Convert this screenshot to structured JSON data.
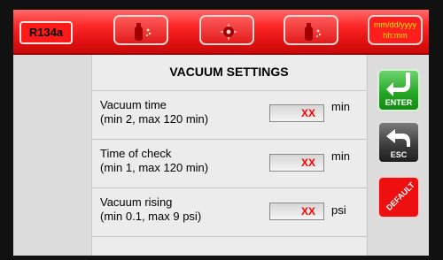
{
  "topbar": {
    "refrigerant": "R134a",
    "datetime_line1": "mm/dd/yyyy",
    "datetime_line2": "hh:mm",
    "icons": [
      "recovery-bottle-icon",
      "vacuum-pump-icon",
      "oil-injection-bottle-icon"
    ]
  },
  "panel": {
    "title": "VACUUM SETTINGS",
    "rows": [
      {
        "line1": "Vacuum time",
        "line2": "(min 2, max 120 min)",
        "value": "XX",
        "unit": "min"
      },
      {
        "line1": "Time of check",
        "line2": "(min 1, max 120 min)",
        "value": "XX",
        "unit": "min"
      },
      {
        "line1": "Vacuum rising",
        "line2": "(min 0.1, max 9 psi)",
        "value": "XX",
        "unit": "psi"
      }
    ]
  },
  "buttons": {
    "enter": "ENTER",
    "esc": "ESC",
    "default": "DEFAULT"
  },
  "colors": {
    "topbar": "#e41212",
    "value_text": "#ff0000",
    "date_text": "#ffe600",
    "enter_button": "#24a424",
    "esc_button": "#3a3a3a",
    "default_button": "#ee1010"
  }
}
